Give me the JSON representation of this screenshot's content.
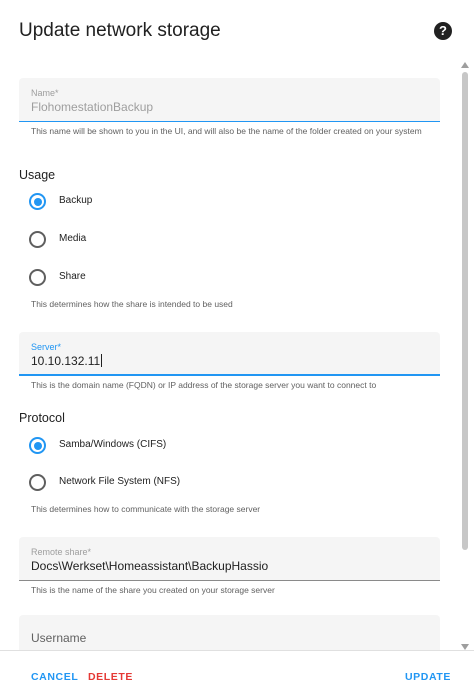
{
  "dialog": {
    "title": "Update network storage",
    "help_icon": "help-circle-icon"
  },
  "name_field": {
    "label": "Name*",
    "value": "FlohomestationBackup",
    "helper": "This name will be shown to you in the UI, and will also be the name of the folder created on your system"
  },
  "usage": {
    "heading": "Usage",
    "options": [
      {
        "label": "Backup",
        "checked": true
      },
      {
        "label": "Media",
        "checked": false
      },
      {
        "label": "Share",
        "checked": false
      }
    ],
    "helper": "This determines how the share is intended to be used"
  },
  "server_field": {
    "label": "Server*",
    "value": "10.10.132.11",
    "helper": "This is the domain name (FQDN) or IP address of the storage server you want to connect to"
  },
  "protocol": {
    "heading": "Protocol",
    "options": [
      {
        "label": "Samba/Windows (CIFS)",
        "checked": true
      },
      {
        "label": "Network File System (NFS)",
        "checked": false
      }
    ],
    "helper": "This determines how to communicate with the storage server"
  },
  "remote_share_field": {
    "label": "Remote share*",
    "value": "Docs\\Werkset\\Homeassistant\\BackupHassio",
    "helper": "This is the name of the share you created on your storage server"
  },
  "username_field": {
    "label": "Username"
  },
  "footer": {
    "cancel": "CANCEL",
    "delete": "DELETE",
    "update": "UPDATE"
  },
  "colors": {
    "accent": "#2196f3",
    "danger": "#e53935"
  }
}
